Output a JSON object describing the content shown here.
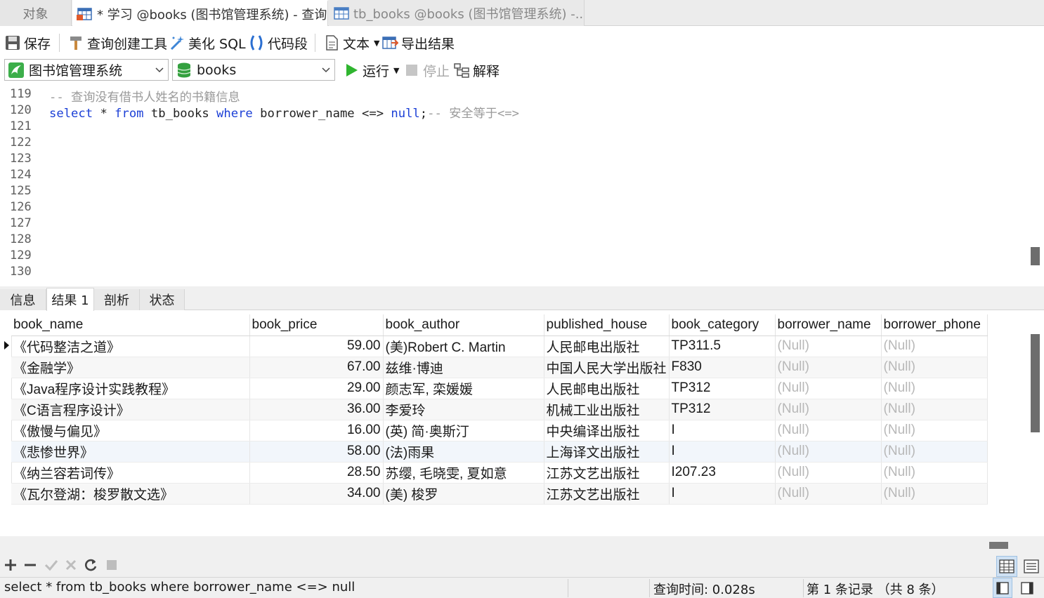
{
  "tabs": {
    "objects": "对象",
    "query": "* 学习 @books (图书馆管理系统) - 查询",
    "table": "tb_books @books (图书馆管理系统) -..."
  },
  "toolbar": {
    "save": "保存",
    "query_builder": "查询创建工具",
    "beautify": "美化 SQL",
    "snippet": "代码段",
    "text": "文本",
    "export": "导出结果"
  },
  "selectors": {
    "connection": "图书馆管理系统",
    "database": "books",
    "run": "运行",
    "stop": "停止",
    "explain": "解释"
  },
  "editor": {
    "lines": [
      {
        "num": "119",
        "parts": [
          {
            "t": "cm",
            "v": "-- 查询没有借书人姓名的书籍信息"
          }
        ]
      },
      {
        "num": "120",
        "parts": [
          {
            "t": "kw",
            "v": "select"
          },
          {
            "t": "tx",
            "v": " * "
          },
          {
            "t": "kw",
            "v": "from"
          },
          {
            "t": "tx",
            "v": " tb_books "
          },
          {
            "t": "kw",
            "v": "where"
          },
          {
            "t": "tx",
            "v": " borrower_name <=> "
          },
          {
            "t": "kw",
            "v": "null"
          },
          {
            "t": "tx",
            "v": ";"
          },
          {
            "t": "cm",
            "v": "-- 安全等于<=>"
          }
        ]
      },
      {
        "num": "121",
        "parts": []
      },
      {
        "num": "122",
        "parts": []
      },
      {
        "num": "123",
        "parts": []
      },
      {
        "num": "124",
        "parts": []
      },
      {
        "num": "125",
        "parts": []
      },
      {
        "num": "126",
        "parts": []
      },
      {
        "num": "127",
        "parts": []
      },
      {
        "num": "128",
        "parts": []
      },
      {
        "num": "129",
        "parts": []
      },
      {
        "num": "130",
        "parts": []
      }
    ]
  },
  "result_tabs": [
    "信息",
    "结果 1",
    "剖析",
    "状态"
  ],
  "grid": {
    "columns": [
      "book_name",
      "book_price",
      "book_author",
      "published_house",
      "book_category",
      "borrower_name",
      "borrower_phone"
    ],
    "rows": [
      [
        "《代码整洁之道》",
        "59.00",
        "(美)Robert C. Martin",
        "人民邮电出版社",
        "TP311.5",
        "(Null)",
        "(Null)"
      ],
      [
        "《金融学》",
        "67.00",
        "兹维·博迪",
        "中国人民大学出版社",
        "F830",
        "(Null)",
        "(Null)"
      ],
      [
        "《Java程序设计实践教程》",
        "29.00",
        "颜志军, 栾媛媛",
        "人民邮电出版社",
        "TP312",
        "(Null)",
        "(Null)"
      ],
      [
        "《C语言程序设计》",
        "36.00",
        "李爱玲",
        "机械工业出版社",
        "TP312",
        "(Null)",
        "(Null)"
      ],
      [
        "《傲慢与偏见》",
        "16.00",
        "(英) 简·奥斯汀",
        "中央编译出版社",
        "I",
        "(Null)",
        "(Null)"
      ],
      [
        "《悲惨世界》",
        "58.00",
        "(法)雨果",
        "上海译文出版社",
        "I",
        "(Null)",
        "(Null)"
      ],
      [
        "《纳兰容若词传》",
        "28.50",
        "苏缨, 毛晓雯, 夏如意",
        "江苏文艺出版社",
        "I207.23",
        "(Null)",
        "(Null)"
      ],
      [
        "《瓦尔登湖：梭罗散文选》",
        "34.00",
        "(美) 梭罗",
        "江苏文艺出版社",
        "I",
        "(Null)",
        "(Null)"
      ]
    ]
  },
  "status": {
    "sql": "select * from tb_books where borrower_name <=> null",
    "query_time": "查询时间: 0.028s",
    "record": "第 1 条记录 （共 8 条）"
  },
  "colors": {
    "keyword": "#1b3fd6",
    "comment": "#9a9a9a",
    "null": "#b8b8b8",
    "run_green": "#2fb52f"
  }
}
